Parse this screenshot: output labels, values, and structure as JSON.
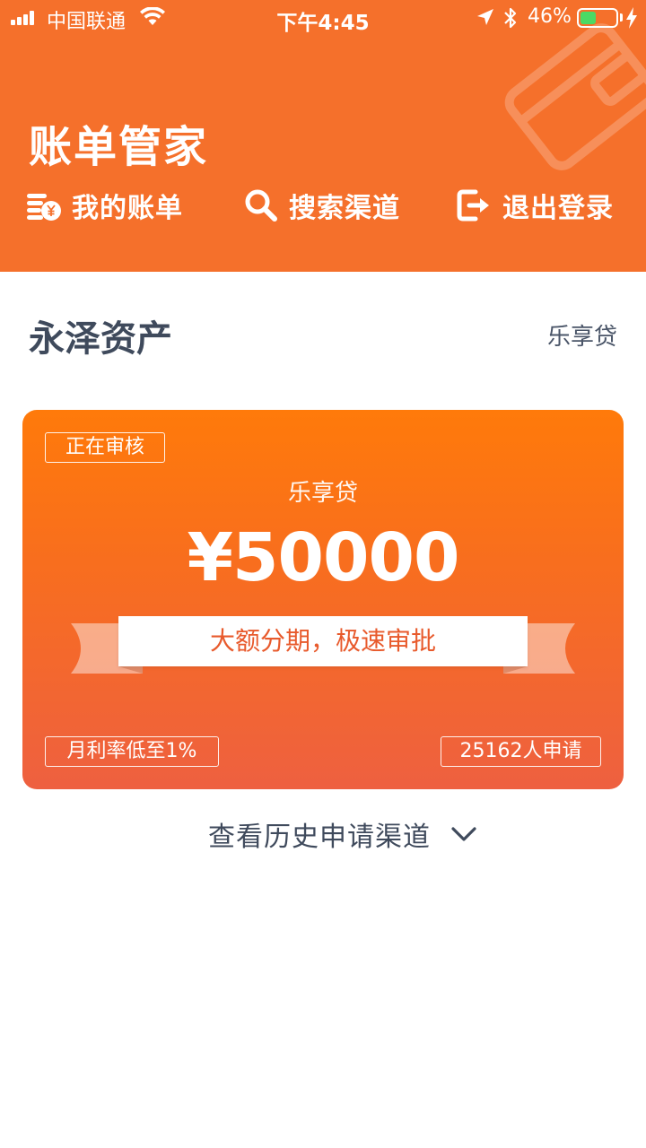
{
  "status_bar": {
    "carrier": "中国联通",
    "time": "下午4:45",
    "battery_percent": "46%",
    "battery_level": 0.46
  },
  "header": {
    "title": "账单管家",
    "nav": [
      {
        "label": "我的账单",
        "icon": "bills-coin-icon"
      },
      {
        "label": "搜索渠道",
        "icon": "search-icon"
      },
      {
        "label": "退出登录",
        "icon": "logout-icon"
      }
    ]
  },
  "section": {
    "title": "永泽资产",
    "link": "乐享贷"
  },
  "card": {
    "status": "正在审核",
    "product": "乐享贷",
    "amount": "¥50000",
    "slogan": "大额分期，极速审批",
    "rate_badge": "月利率低至1%",
    "applicants_badge": "25162人申请"
  },
  "history": {
    "label": "查看历史申请渠道"
  },
  "colors": {
    "header_bg": "#F5702B",
    "card_top": "#FF7A0A",
    "card_bottom": "#EE6040",
    "title_text": "#3F4A5C",
    "slogan_text": "#E85A2C"
  }
}
